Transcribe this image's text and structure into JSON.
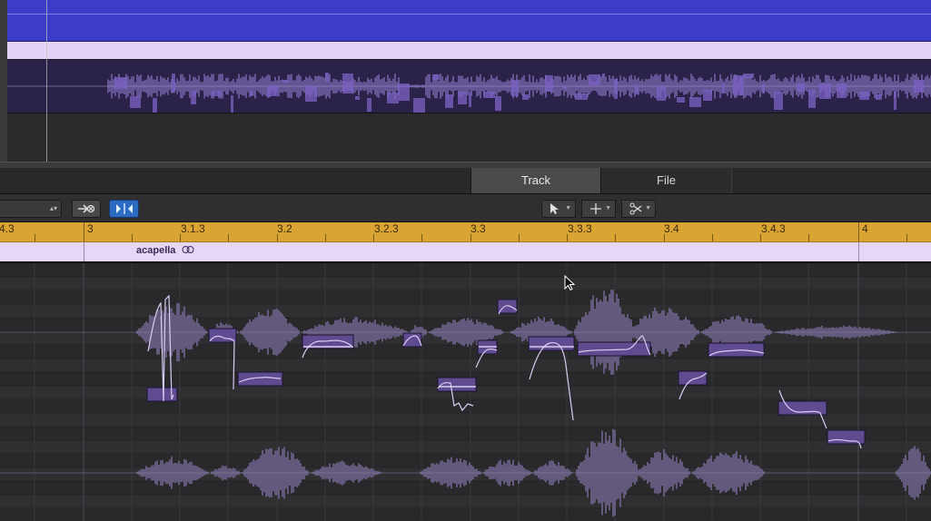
{
  "tabs": [
    {
      "label": "Track",
      "active": true
    },
    {
      "label": "File",
      "active": false
    }
  ],
  "toolbar": {
    "catch_icon": "catch-playhead-icon",
    "flex_icon": "flex-mode-icon",
    "tools": [
      "pointer-tool-icon",
      "marquee-tool-icon",
      "scissors-tool-icon"
    ]
  },
  "ruler": {
    "labels": [
      "4.3",
      "3",
      "3.1.3",
      "3.2",
      "3.2.3",
      "3.3",
      "3.3.3",
      "3.4",
      "3.4.3",
      "4"
    ]
  },
  "region": {
    "name": "acapella",
    "loop_icon": "loop-icon"
  },
  "colors": {
    "top_track": "#3b3cc8",
    "region_header": "#e6d6f8",
    "ruler": "#d9a431",
    "note": "#5f4b8f",
    "selected_tool": "#2d6ac2"
  }
}
